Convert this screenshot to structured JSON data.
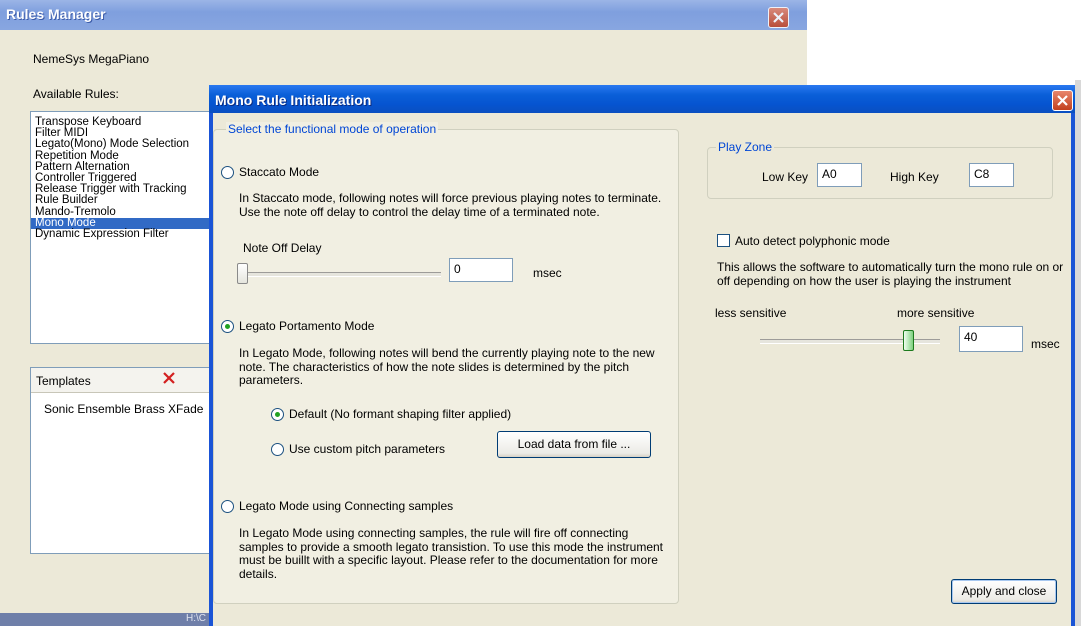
{
  "rules_manager": {
    "title": "Rules Manager",
    "instrument_name": "NemeSys MegaPiano",
    "available_rules_label": "Available Rules:",
    "rules": [
      {
        "label": "Transpose Keyboard",
        "selected": false
      },
      {
        "label": "Filter MIDI",
        "selected": false
      },
      {
        "label": "Legato(Mono) Mode Selection",
        "selected": false
      },
      {
        "label": "Repetition Mode",
        "selected": false
      },
      {
        "label": "Pattern Alternation",
        "selected": false
      },
      {
        "label": "Controller Triggered",
        "selected": false
      },
      {
        "label": "Release Trigger with Tracking",
        "selected": false
      },
      {
        "label": "Rule Builder",
        "selected": false
      },
      {
        "label": "Mando-Tremolo",
        "selected": false
      },
      {
        "label": "Mono Mode",
        "selected": true
      },
      {
        "label": "Dynamic Expression Filter",
        "selected": false
      }
    ],
    "templates_header": "Templates",
    "templates": [
      "Sonic Ensemble Brass XFade"
    ],
    "status_text": "H:\\C"
  },
  "mono_dialog": {
    "title": "Mono Rule Initialization",
    "mode_group_legend": "Select the functional mode of operation",
    "staccato": {
      "label": "Staccato Mode",
      "selected": false,
      "description": "In Staccato mode, following notes will force previous playing notes to terminate. Use the note off delay to control the delay time of a terminated note.",
      "note_off_label": "Note Off Delay",
      "note_off_value": "0",
      "note_off_unit": "msec",
      "note_off_level": 0
    },
    "legato_portamento": {
      "label": "Legato Portamento Mode",
      "selected": true,
      "description": "In Legato Mode, following notes will bend the currently playing note to the new note. The characteristics of how the note slides is determined by the pitch parameters.",
      "default_option": "Default (No formant shaping filter applied)",
      "custom_option": "Use custom pitch parameters",
      "load_button": "Load data from file ..."
    },
    "legato_connecting": {
      "label": "Legato Mode using Connecting samples",
      "selected": false,
      "description": "In Legato Mode using connecting samples, the rule will fire off connecting samples to provide a smooth legato transistion. To use this mode the instrument must be buillt with a specific layout. Please refer to the documentation for more details."
    },
    "play_zone": {
      "legend": "Play Zone",
      "low_key_label": "Low Key",
      "low_key_value": "A0",
      "high_key_label": "High Key",
      "high_key_value": "C8"
    },
    "auto_detect": {
      "label": "Auto detect polyphonic mode",
      "checked": false,
      "description": "This allows the software to automatically turn the mono rule on or off depending on how the user is playing the instrument",
      "less_label": "less sensitive",
      "more_label": "more sensitive",
      "value": "40",
      "unit": "msec",
      "level": 0.85
    },
    "apply_button": "Apply and close"
  },
  "colors": {
    "title_bar": "#0a5fd8",
    "dialog_face": "#ece9d8",
    "group_face": "#f1efe2",
    "selection": "#316ac5",
    "delete_icon": "#d32020"
  }
}
